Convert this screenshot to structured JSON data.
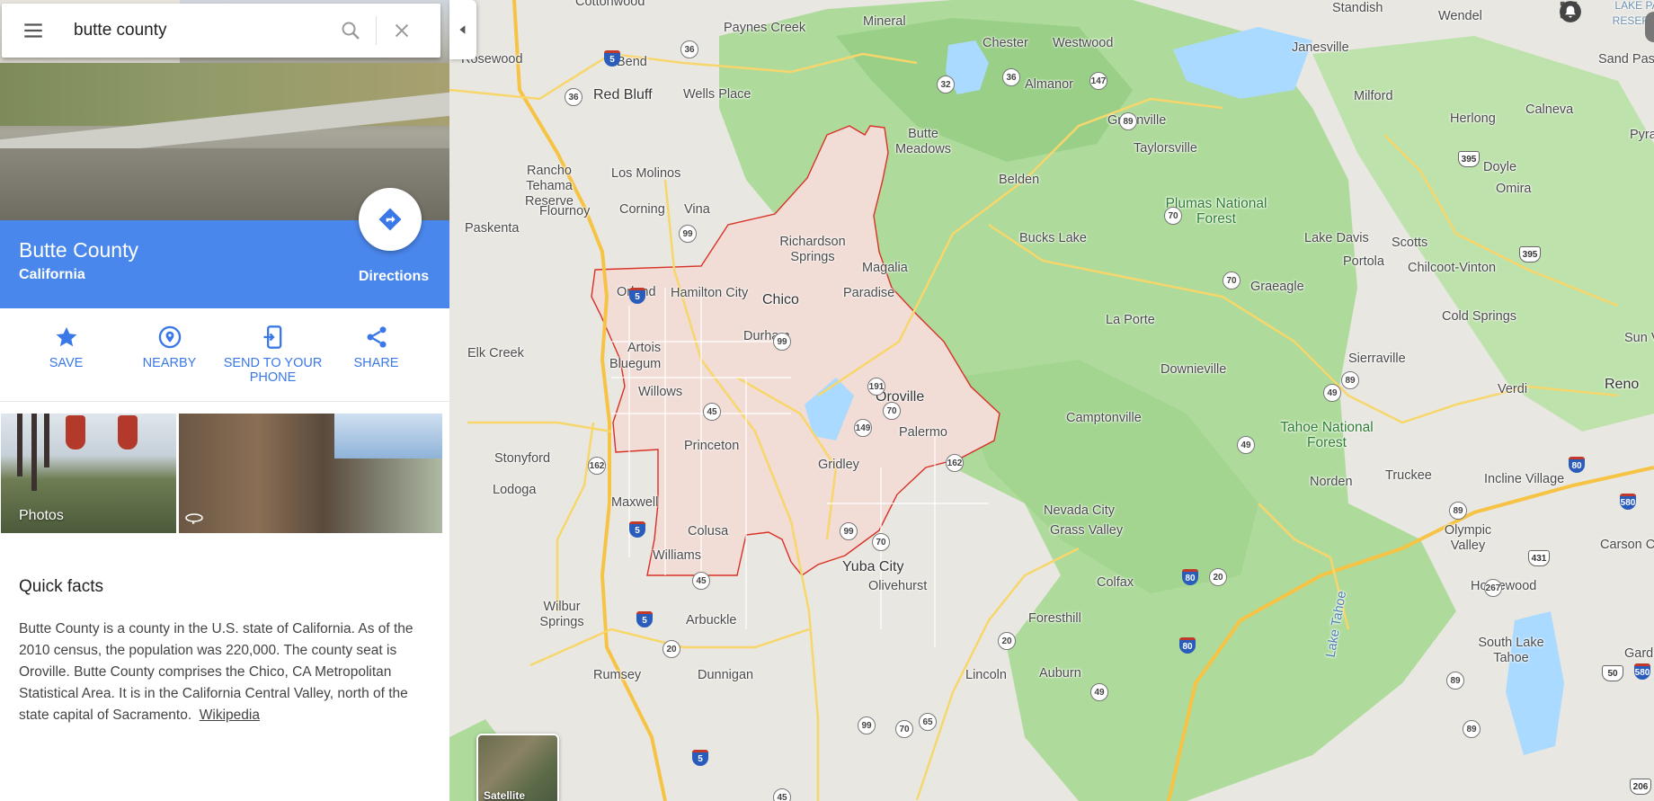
{
  "search": {
    "query": "butte county"
  },
  "place": {
    "title": "Butte County",
    "subtitle": "California",
    "directions_label": "Directions"
  },
  "actions": [
    {
      "label": "SAVE",
      "icon": "star-icon"
    },
    {
      "label": "NEARBY",
      "icon": "nearby-pin-icon"
    },
    {
      "label": "SEND TO YOUR PHONE",
      "icon": "send-to-phone-icon"
    },
    {
      "label": "SHARE",
      "icon": "share-icon"
    }
  ],
  "photos": {
    "label": "Photos"
  },
  "quick_facts": {
    "title": "Quick facts",
    "body": "Butte County is a county in the U.S. state of California. As of the 2010 census, the population was 220,000. The county seat is Oroville. Butte County comprises the Chico, CA Metropolitan Statistical Area. It is in the California Central Valley, north of the state capital of Sacramento.",
    "link": "Wikipedia"
  },
  "map": {
    "satellite_label": "Satellite",
    "highlight_color": "#d93025",
    "places": [
      {
        "name": "Cottonwood",
        "cls": ""
      },
      {
        "name": "Paynes Creek",
        "cls": ""
      },
      {
        "name": "Mineral",
        "cls": ""
      },
      {
        "name": "Chester",
        "cls": ""
      },
      {
        "name": "Westwood",
        "cls": ""
      },
      {
        "name": "Standish",
        "cls": ""
      },
      {
        "name": "Wendel",
        "cls": ""
      },
      {
        "name": "Janesville",
        "cls": ""
      },
      {
        "name": "Sand Pass",
        "cls": ""
      },
      {
        "name": "Rosewood",
        "cls": ""
      },
      {
        "name": "Bend",
        "cls": ""
      },
      {
        "name": "Red Bluff",
        "cls": "big"
      },
      {
        "name": "Wells Place",
        "cls": ""
      },
      {
        "name": "Almanor",
        "cls": ""
      },
      {
        "name": "Greenville",
        "cls": ""
      },
      {
        "name": "Milford",
        "cls": ""
      },
      {
        "name": "Herlong",
        "cls": ""
      },
      {
        "name": "Calneva",
        "cls": ""
      },
      {
        "name": "Butte Meadows",
        "cls": ""
      },
      {
        "name": "Taylorsville",
        "cls": ""
      },
      {
        "name": "Pyrar",
        "cls": ""
      },
      {
        "name": "Rancho Tehama Reserve",
        "cls": ""
      },
      {
        "name": "Los Molinos",
        "cls": ""
      },
      {
        "name": "Belden",
        "cls": ""
      },
      {
        "name": "Doyle",
        "cls": ""
      },
      {
        "name": "Omira",
        "cls": ""
      },
      {
        "name": "Flournoy",
        "cls": ""
      },
      {
        "name": "Corning",
        "cls": ""
      },
      {
        "name": "Vina",
        "cls": ""
      },
      {
        "name": "Plumas National Forest",
        "cls": "forest"
      },
      {
        "name": "Paskenta",
        "cls": ""
      },
      {
        "name": "Bucks Lake",
        "cls": ""
      },
      {
        "name": "Lake Davis",
        "cls": ""
      },
      {
        "name": "Scotts",
        "cls": ""
      },
      {
        "name": "Richardson Springs",
        "cls": ""
      },
      {
        "name": "Magalia",
        "cls": ""
      },
      {
        "name": "Portola",
        "cls": ""
      },
      {
        "name": "Chilcoot-Vinton",
        "cls": ""
      },
      {
        "name": "Graeagle",
        "cls": ""
      },
      {
        "name": "Orland",
        "cls": ""
      },
      {
        "name": "Hamilton City",
        "cls": ""
      },
      {
        "name": "Chico",
        "cls": "big"
      },
      {
        "name": "Paradise",
        "cls": ""
      },
      {
        "name": "La Porte",
        "cls": ""
      },
      {
        "name": "Cold Springs",
        "cls": ""
      },
      {
        "name": "Durham",
        "cls": ""
      },
      {
        "name": "Sun Valley",
        "cls": ""
      },
      {
        "name": "Artois",
        "cls": ""
      },
      {
        "name": "Elk Creek",
        "cls": ""
      },
      {
        "name": "Bluegum",
        "cls": ""
      },
      {
        "name": "Sierraville",
        "cls": ""
      },
      {
        "name": "Downieville",
        "cls": ""
      },
      {
        "name": "Willows",
        "cls": ""
      },
      {
        "name": "Oroville",
        "cls": "big"
      },
      {
        "name": "Verdi",
        "cls": ""
      },
      {
        "name": "Reno",
        "cls": "big"
      },
      {
        "name": "Camptonville",
        "cls": ""
      },
      {
        "name": "Palermo",
        "cls": ""
      },
      {
        "name": "Tahoe National Forest",
        "cls": "forest"
      },
      {
        "name": "Princeton",
        "cls": ""
      },
      {
        "name": "Stonyford",
        "cls": ""
      },
      {
        "name": "Gridley",
        "cls": ""
      },
      {
        "name": "Truckee",
        "cls": ""
      },
      {
        "name": "Norden",
        "cls": ""
      },
      {
        "name": "Incline Village",
        "cls": ""
      },
      {
        "name": "Lodoga",
        "cls": ""
      },
      {
        "name": "Maxwell",
        "cls": ""
      },
      {
        "name": "Nevada City",
        "cls": ""
      },
      {
        "name": "Colusa",
        "cls": ""
      },
      {
        "name": "Grass Valley",
        "cls": ""
      },
      {
        "name": "Olympic Valley",
        "cls": ""
      },
      {
        "name": "Carson C",
        "cls": ""
      },
      {
        "name": "Williams",
        "cls": ""
      },
      {
        "name": "Yuba City",
        "cls": "big"
      },
      {
        "name": "Colfax",
        "cls": ""
      },
      {
        "name": "Olivehurst",
        "cls": ""
      },
      {
        "name": "Homewood",
        "cls": ""
      },
      {
        "name": "Wilbur Springs",
        "cls": ""
      },
      {
        "name": "Arbuckle",
        "cls": ""
      },
      {
        "name": "Foresthill",
        "cls": ""
      },
      {
        "name": "South Lake Tahoe",
        "cls": ""
      },
      {
        "name": "Gardner",
        "cls": ""
      },
      {
        "name": "Rumsey",
        "cls": ""
      },
      {
        "name": "Dunnigan",
        "cls": ""
      },
      {
        "name": "Lincoln",
        "cls": ""
      },
      {
        "name": "Auburn",
        "cls": ""
      },
      {
        "name": "Lake Tahoe",
        "cls": ""
      },
      {
        "name": "LAKE PAS RESERVAT",
        "cls": ""
      }
    ],
    "routes": [
      "5",
      "36",
      "36",
      "32",
      "36",
      "147",
      "89",
      "395",
      "99",
      "70",
      "70",
      "5",
      "99",
      "191",
      "70",
      "149",
      "162",
      "45",
      "162",
      "89",
      "49",
      "395",
      "80",
      "89",
      "49",
      "5",
      "99",
      "70",
      "45",
      "5",
      "20",
      "20",
      "20",
      "80",
      "267",
      "431",
      "89",
      "80",
      "50",
      "580",
      "49",
      "99",
      "70",
      "65",
      "89",
      "5",
      "45",
      "206",
      "580"
    ]
  }
}
